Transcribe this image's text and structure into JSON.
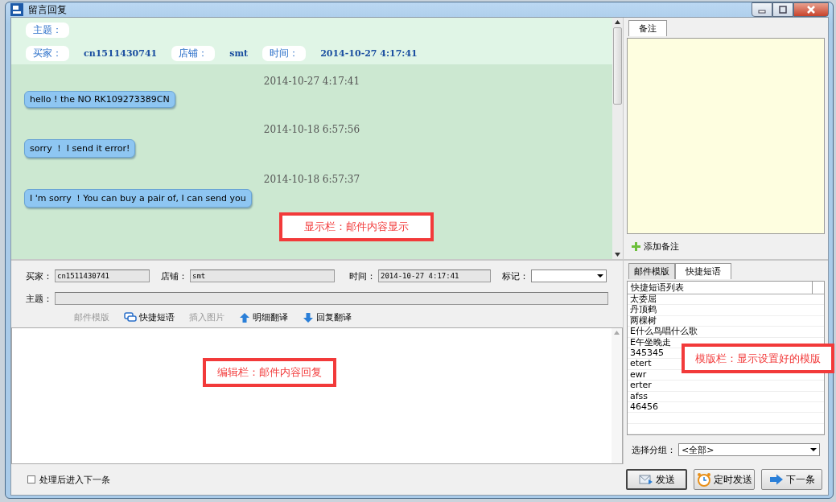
{
  "window": {
    "title": "留言回复"
  },
  "display": {
    "subject_label": "主题：",
    "fields": [
      {
        "label": "买家：",
        "value": "cn1511430741"
      },
      {
        "label": "店铺：",
        "value": "smt"
      },
      {
        "label": "时间：",
        "value": "2014-10-27 4:17:41"
      }
    ],
    "messages": [
      {
        "time": "2014-10-27 4:17:41",
        "text": "hello ! the NO RK109273389CN"
      },
      {
        "time": "2014-10-18 6:57:56",
        "text": "sorry ！ I send it error!"
      },
      {
        "time": "2014-10-18 6:57:37",
        "text": "I  'm sorry ！You can buy a pair of, I can send you"
      }
    ]
  },
  "editor": {
    "fields": [
      {
        "label": "买家：",
        "value": "cn1511430741",
        "kind": "text"
      },
      {
        "label": "店铺：",
        "value": "smt",
        "kind": "text"
      },
      {
        "label": "时间：",
        "value": "2014-10-27 4:17:41",
        "kind": "text"
      },
      {
        "label": "标记：",
        "kind": "select"
      }
    ],
    "subject": {
      "label": "主题："
    },
    "toolbar": [
      {
        "label": "邮件模版",
        "kind": "none",
        "disabled": true
      },
      {
        "label": "快捷短语",
        "kind": "chat",
        "disabled": false
      },
      {
        "label": "插入图片",
        "kind": "none",
        "disabled": true
      },
      {
        "label": "明细翻译",
        "kind": "up",
        "disabled": false
      },
      {
        "label": "回复翻译",
        "kind": "down",
        "disabled": false
      }
    ]
  },
  "notes": {
    "tabs": [
      {
        "label": "备注",
        "selected": true
      }
    ],
    "add_button": "添加备注"
  },
  "templates": {
    "tabs": [
      {
        "label": "邮件模版",
        "selected": false
      },
      {
        "label": "快捷短语",
        "selected": true
      }
    ],
    "list_header": "快捷短语列表",
    "items": [
      "太委屈",
      "丹顶鹤",
      "两棵树",
      "E什么鸟唱什么歌",
      "E午坐晚走",
      "345345",
      "etert",
      "ewr",
      "erter",
      "afss",
      "46456"
    ],
    "group": {
      "label": "选择分组：",
      "value": "<全部>"
    }
  },
  "footer": {
    "checkbox": {
      "label": "处理后进入下一条",
      "checked": false
    },
    "buttons": [
      {
        "label": "发送",
        "kind": "send"
      },
      {
        "label": "定时发送",
        "kind": "timer"
      },
      {
        "label": "下一条",
        "kind": "next"
      }
    ]
  },
  "annotations": [
    {
      "text": "显示栏：邮件内容显示",
      "kind": "display"
    },
    {
      "text": "编辑栏：邮件内容回复",
      "kind": "editor"
    },
    {
      "text": "模版栏：显示设置好的模版",
      "kind": "templates"
    }
  ]
}
